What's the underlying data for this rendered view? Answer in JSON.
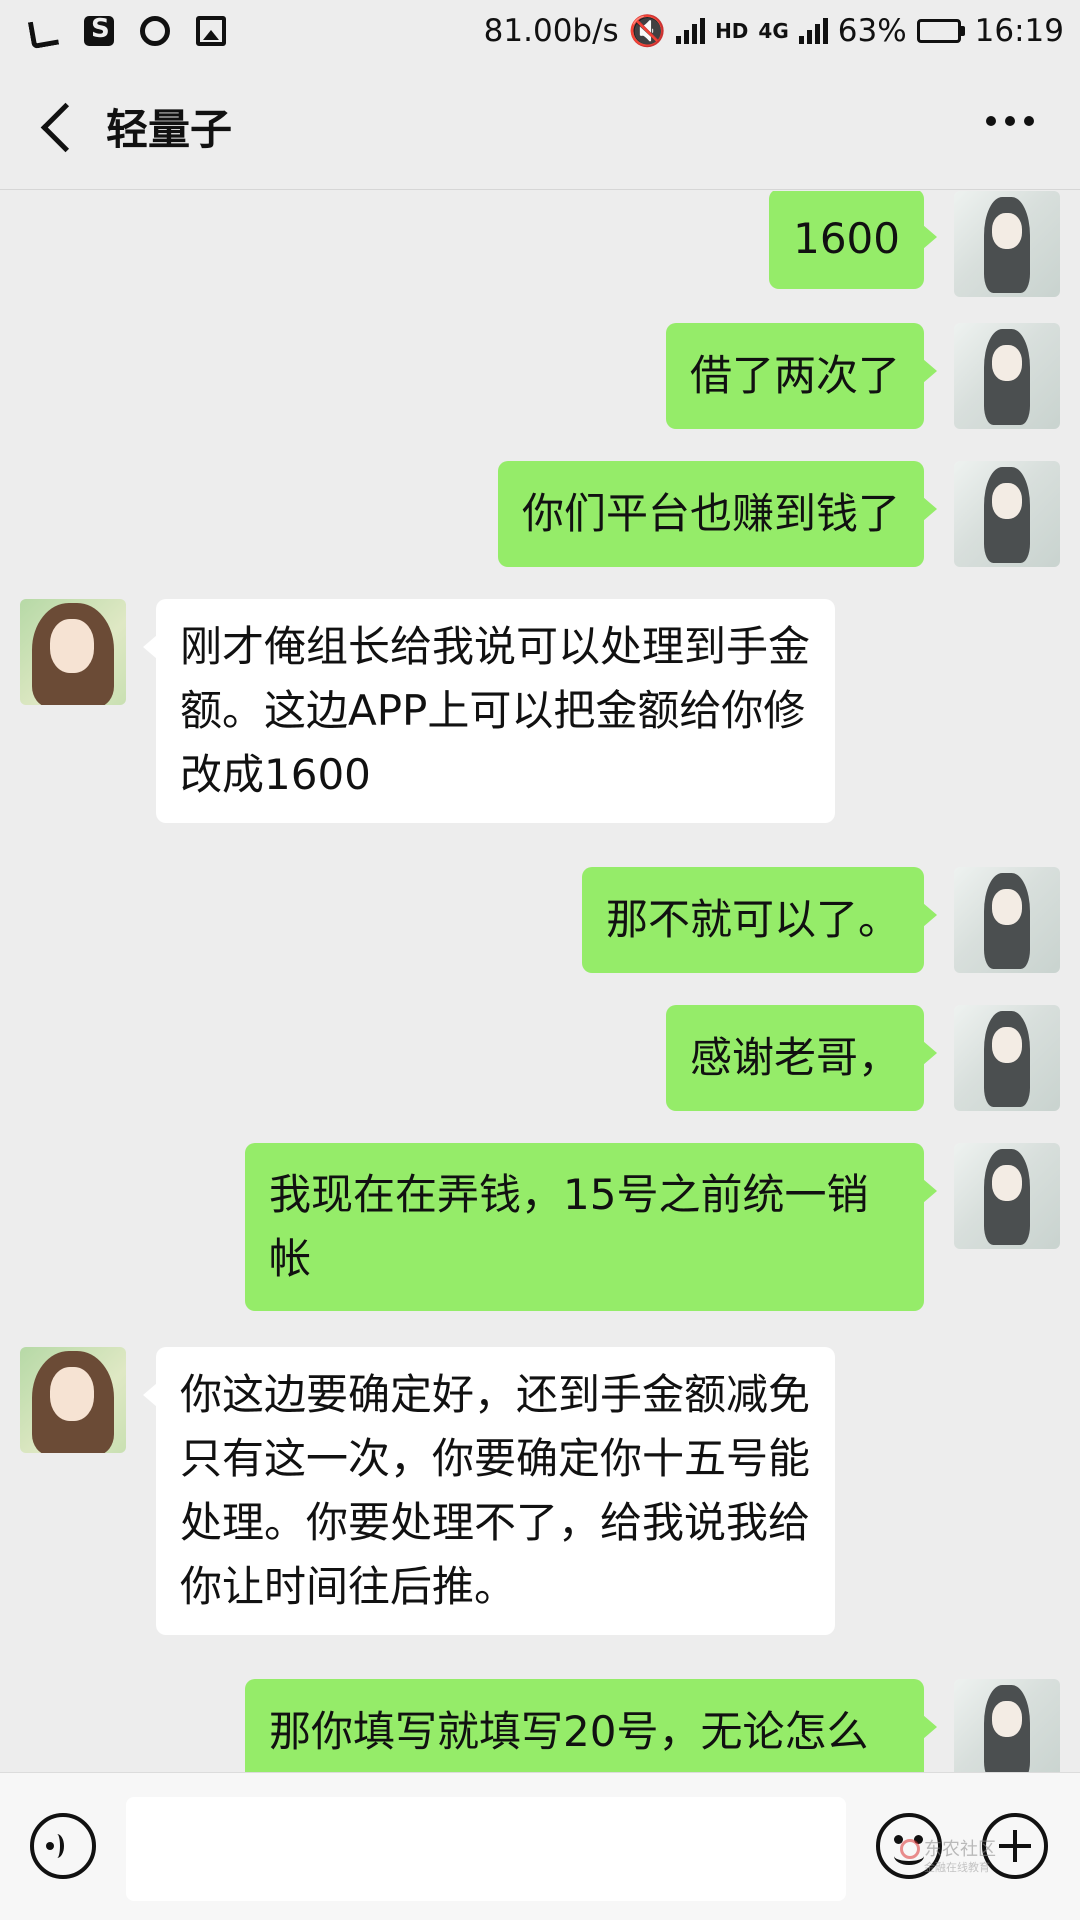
{
  "status_bar": {
    "speed": "81.00b/s",
    "network_hd": "HD",
    "network_type": "4G",
    "battery_percent": "63%",
    "battery_level": 0.63,
    "time": "16:19"
  },
  "nav": {
    "title": "轻量子"
  },
  "messages": [
    {
      "side": "right",
      "text": "1600"
    },
    {
      "side": "right",
      "text": "借了两次了"
    },
    {
      "side": "right",
      "text": "你们平台也赚到钱了"
    },
    {
      "side": "left",
      "text": "刚才俺组长给我说可以处理到手金额。这边APP上可以把金额给你修改成1600"
    },
    {
      "side": "right",
      "text": "那不就可以了。"
    },
    {
      "side": "right",
      "text": "感谢老哥，"
    },
    {
      "side": "right",
      "text": "我现在在弄钱，15号之前统一销帐"
    },
    {
      "side": "left",
      "text": "你这边要确定好，还到手金额减免只有这一次，你要确定你十五号能处理。你要处理不了，给我说我给你让时间往后推。"
    },
    {
      "side": "right",
      "text": "那你填写就填写20号，无论怎么"
    }
  ],
  "watermark": {
    "line1": "东农社区",
    "line2": "金融在线教育"
  },
  "icons": {
    "back": "back-arrow-icon",
    "more": "more-dots-icon",
    "voice": "voice-icon",
    "emoji": "emoji-icon",
    "plus": "plus-icon"
  },
  "colors": {
    "outgoing_bubble": "#95ec69",
    "incoming_bubble": "#ffffff",
    "background": "#ededed"
  }
}
